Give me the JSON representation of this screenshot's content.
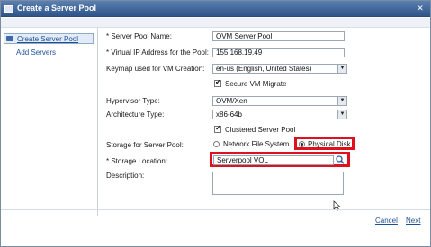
{
  "window": {
    "title": "Create a Server Pool",
    "close_glyph": "✕"
  },
  "nav": {
    "items": [
      {
        "label": "Create Server Pool",
        "active": true
      },
      {
        "label": "Add Servers",
        "active": false
      }
    ]
  },
  "form": {
    "server_pool_name": {
      "label": "* Server Pool Name:",
      "value": "OVM Server Pool"
    },
    "virtual_ip": {
      "label": "* Virtual IP Address for the Pool:",
      "value": "155.168.19.49"
    },
    "keymap": {
      "label": "Keymap used for VM Creation:",
      "value": "en-us (English, United States)"
    },
    "secure_vm_migrate": {
      "label": "Secure VM Migrate",
      "checked": true
    },
    "hypervisor_type": {
      "label": "Hypervisor Type:",
      "value": "OVM/Xen"
    },
    "architecture_type": {
      "label": "Architecture Type:",
      "value": "x86-64b"
    },
    "clustered_server_pool": {
      "label": "Clustered Server Pool",
      "checked": true
    },
    "storage_for_pool": {
      "label": "Storage for Server Pool:",
      "options": [
        {
          "label": "Network File System",
          "selected": false
        },
        {
          "label": "Physical Disk",
          "selected": true
        }
      ]
    },
    "storage_location": {
      "label": "* Storage Location:",
      "value": "Serverpool VOL"
    },
    "description": {
      "label": "Description:",
      "value": ""
    }
  },
  "buttons": {
    "cancel": "Cancel",
    "next": "Next"
  },
  "colors": {
    "highlight": "#e0101c",
    "titlebar": "#2f5489",
    "link": "#1d4f96"
  }
}
